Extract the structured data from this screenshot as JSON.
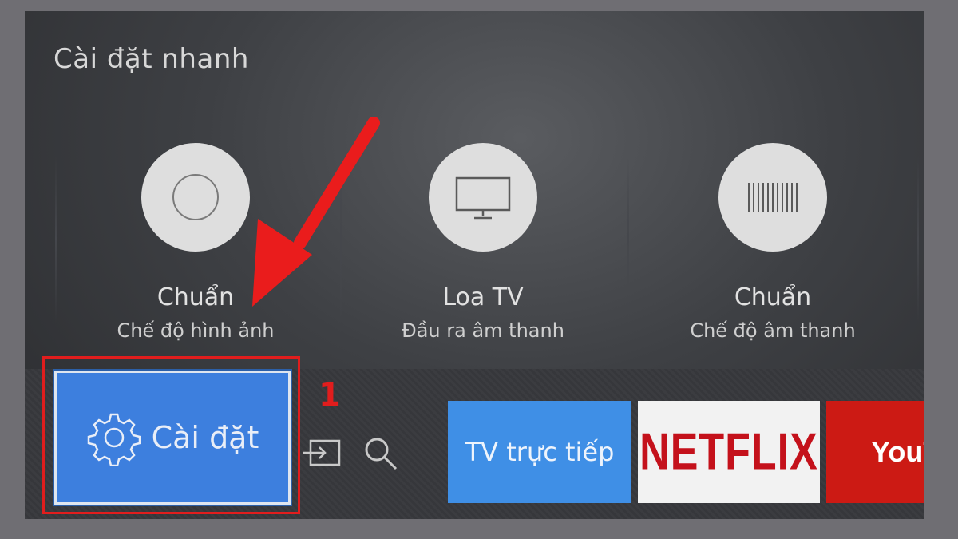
{
  "quick_settings": {
    "title": "Cài đặt nhanh",
    "items": [
      {
        "title": "Chuẩn",
        "subtitle": "Chế độ hình ảnh",
        "icon": "picture-mode-icon"
      },
      {
        "title": "Loa TV",
        "subtitle": "Đầu ra âm thanh",
        "icon": "tv-speaker-icon"
      },
      {
        "title": "Chuẩn",
        "subtitle": "Chế độ âm thanh",
        "icon": "sound-mode-icon"
      }
    ]
  },
  "bottom_bar": {
    "settings_label": "Cài đặt",
    "apps": {
      "live_tv": "TV trực tiếp",
      "netflix": "NETFLIX",
      "youtube": "YouTube"
    }
  },
  "annotation": {
    "step_number": "1",
    "color": "#e11d1d"
  },
  "colors": {
    "settings_button": "#3d7fde",
    "live_tv_tile": "#3f8fe6",
    "netflix_red": "#c4111b",
    "youtube_red": "#cc1a14"
  }
}
